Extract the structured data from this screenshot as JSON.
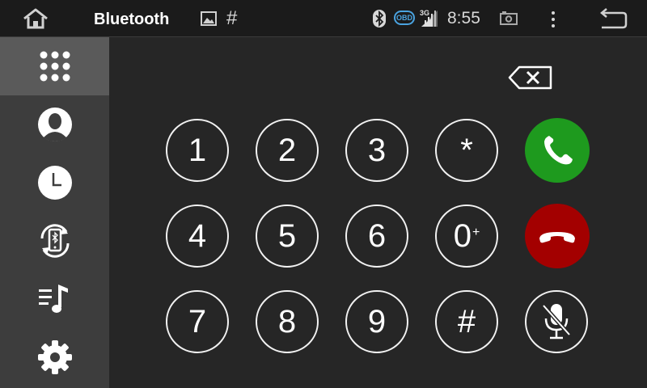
{
  "topbar": {
    "title": "Bluetooth",
    "hash": "#",
    "obd": "OBD",
    "network": "3G",
    "time": "8:55",
    "icons": [
      "home-icon",
      "picture-icon",
      "hash-icon",
      "bluetooth-icon",
      "signal-icon",
      "screenshot-icon",
      "more-icon",
      "back-icon"
    ]
  },
  "sidebar": {
    "items": [
      {
        "name": "dialpad",
        "icon": "dialpad-icon",
        "active": true
      },
      {
        "name": "contacts",
        "icon": "contact-icon",
        "active": false
      },
      {
        "name": "call-log",
        "icon": "clock-icon",
        "active": false
      },
      {
        "name": "phone-sync",
        "icon": "sync-icon",
        "active": false
      },
      {
        "name": "music",
        "icon": "music-icon",
        "active": false
      },
      {
        "name": "settings",
        "icon": "gear-icon",
        "active": false
      }
    ]
  },
  "keypad": {
    "keys": [
      "1",
      "2",
      "3",
      "*",
      "4",
      "5",
      "6",
      "0",
      "7",
      "8",
      "9",
      "#"
    ],
    "zero_plus": "+"
  },
  "colors": {
    "call_green": "#1e9a1e",
    "hangup_red": "#a30000",
    "obd_blue": "#4aa3e0"
  }
}
